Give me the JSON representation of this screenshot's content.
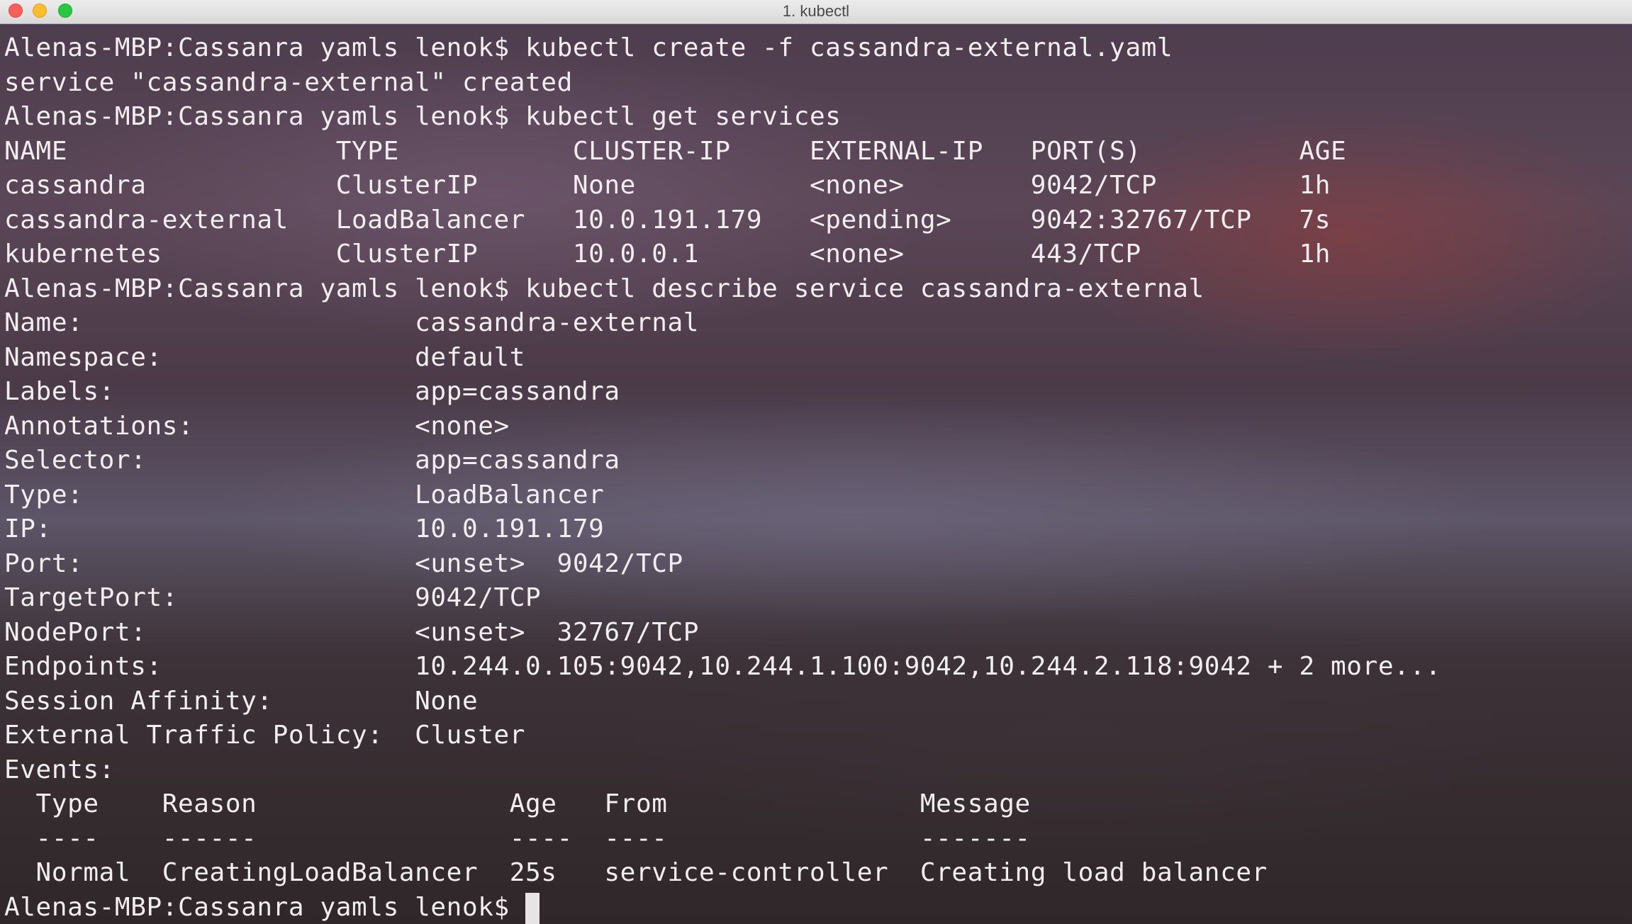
{
  "window": {
    "title": "1. kubectl"
  },
  "terminal": {
    "lines": [
      "Alenas-MBP:Cassanra yamls lenok$ kubectl create -f cassandra-external.yaml",
      "service \"cassandra-external\" created",
      "Alenas-MBP:Cassanra yamls lenok$ kubectl get services",
      "NAME                 TYPE           CLUSTER-IP     EXTERNAL-IP   PORT(S)          AGE",
      "cassandra            ClusterIP      None           <none>        9042/TCP         1h",
      "cassandra-external   LoadBalancer   10.0.191.179   <pending>     9042:32767/TCP   7s",
      "kubernetes           ClusterIP      10.0.0.1       <none>        443/TCP          1h",
      "Alenas-MBP:Cassanra yamls lenok$ kubectl describe service cassandra-external",
      "Name:                     cassandra-external",
      "Namespace:                default",
      "Labels:                   app=cassandra",
      "Annotations:              <none>",
      "Selector:                 app=cassandra",
      "Type:                     LoadBalancer",
      "IP:                       10.0.191.179",
      "Port:                     <unset>  9042/TCP",
      "TargetPort:               9042/TCP",
      "NodePort:                 <unset>  32767/TCP",
      "Endpoints:                10.244.0.105:9042,10.244.1.100:9042,10.244.2.118:9042 + 2 more...",
      "Session Affinity:         None",
      "External Traffic Policy:  Cluster",
      "Events:",
      "  Type    Reason                Age   From                Message",
      "  ----    ------                ----  ----                -------",
      "  Normal  CreatingLoadBalancer  25s   service-controller  Creating load balancer"
    ],
    "prompt": "Alenas-MBP:Cassanra yamls lenok$"
  }
}
